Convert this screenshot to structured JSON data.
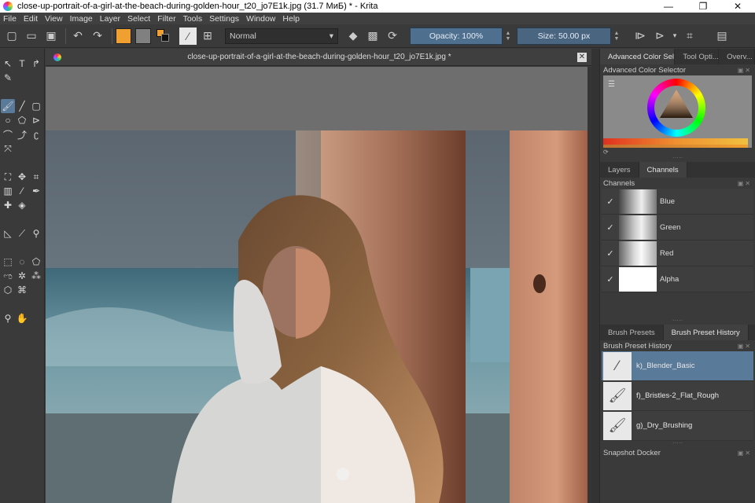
{
  "window": {
    "title": "close-up-portrait-of-a-girl-at-the-beach-during-golden-hour_t20_jo7E1k.jpg (31.7 МиБ)  * - Krita",
    "minimize": "—",
    "maximize": "❐",
    "close": "✕"
  },
  "menu": [
    "File",
    "Edit",
    "View",
    "Image",
    "Layer",
    "Select",
    "Filter",
    "Tools",
    "Settings",
    "Window",
    "Help"
  ],
  "toolbar": {
    "blend_mode": "Normal",
    "opacity_label": "Opacity: 100%",
    "opacity_value": 100,
    "size_label": "Size: 50.00 px",
    "colors": {
      "foreground": "#f0a030",
      "background": "#808080",
      "accent": "#4f6f8f"
    }
  },
  "document": {
    "tab_title": "close-up-portrait-of-a-girl-at-the-beach-during-golden-hour_t20_jo7E1k.jpg *"
  },
  "dockers": {
    "top_tabs": [
      "Advanced Color Sele...",
      "Tool Opti...",
      "Overv..."
    ],
    "color_selector_title": "Advanced Color Selector",
    "layers_tabs": [
      "Layers",
      "Channels"
    ],
    "channels_title": "Channels",
    "channels": [
      {
        "name": "Blue",
        "checked": "✓"
      },
      {
        "name": "Green",
        "checked": "✓"
      },
      {
        "name": "Red",
        "checked": "✓"
      },
      {
        "name": "Alpha",
        "checked": "✓"
      }
    ],
    "brush_tabs": [
      "Brush Presets",
      "Brush Preset History"
    ],
    "brush_history_title": "Brush Preset History",
    "brush_history": [
      {
        "name": "k)_Blender_Basic",
        "selected": true
      },
      {
        "name": "f)_Bristles-2_Flat_Rough",
        "selected": false
      },
      {
        "name": "g)_Dry_Brushing",
        "selected": false
      }
    ],
    "snapshot_title": "Snapshot Docker"
  }
}
